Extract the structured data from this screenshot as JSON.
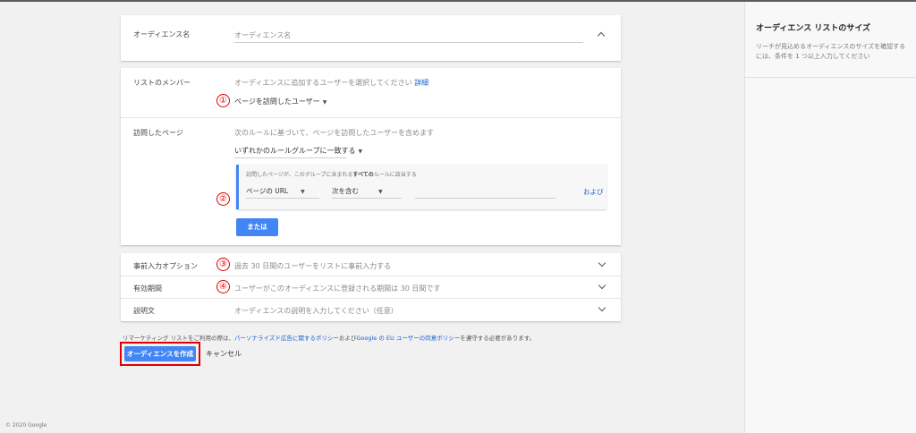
{
  "name_card": {
    "label": "オーディエンス名",
    "placeholder": "オーディエンス名"
  },
  "members_card": {
    "members_label": "リストのメンバー",
    "members_hint": "オーディエンスに追加するユーザーを選択してください",
    "members_link": "詳細",
    "members_value": "ページを訪問したユーザー",
    "visited_label": "訪問したページ",
    "visited_hint": "次のルールに基づいて、ページを訪問したユーザーを含めます",
    "group_match_value": "いずれかのルールグループに一致する",
    "rule_group_desc_prefix": "訪問したページが、このグループに含まれる",
    "rule_group_desc_bold": "すべての",
    "rule_group_desc_suffix": "ルールに該当する",
    "rule_field": "ページの URL",
    "rule_operator": "次を含む",
    "and_link": "および",
    "or_button": "または"
  },
  "options_card": {
    "prefill_label": "事前入力オプション",
    "prefill_value": "過去 30 日間のユーザーをリストに事前入力する",
    "duration_label": "有効期間",
    "duration_value": "ユーザーがこのオーディエンスに登録される期間は 30 日間です",
    "description_label": "説明文",
    "description_placeholder": "オーディエンスの説明を入力してください（任意）"
  },
  "annotations": {
    "one": "①",
    "two": "②",
    "three": "③",
    "four": "④"
  },
  "notice": {
    "prefix": "リマーケティング リストをご利用の際は、",
    "link1": "パーソナライズド広告に関するポリシー",
    "middle": "および",
    "link2": "Google の EU ユーザーの同意ポリシー",
    "suffix": "を遵守する必要があります。"
  },
  "actions": {
    "create_label": "オーディエンスを作成",
    "cancel_label": "キャンセル"
  },
  "right_panel": {
    "title": "オーディエンス リストのサイズ",
    "description": "リーチが見込めるオーディエンスのサイズを確認するには、条件を 1 つ以上入力してください"
  },
  "footer": "© 2020 Google",
  "colors": {
    "accent": "#4285f4",
    "link": "#1a5fd0",
    "annotation_red": "#e00000"
  }
}
